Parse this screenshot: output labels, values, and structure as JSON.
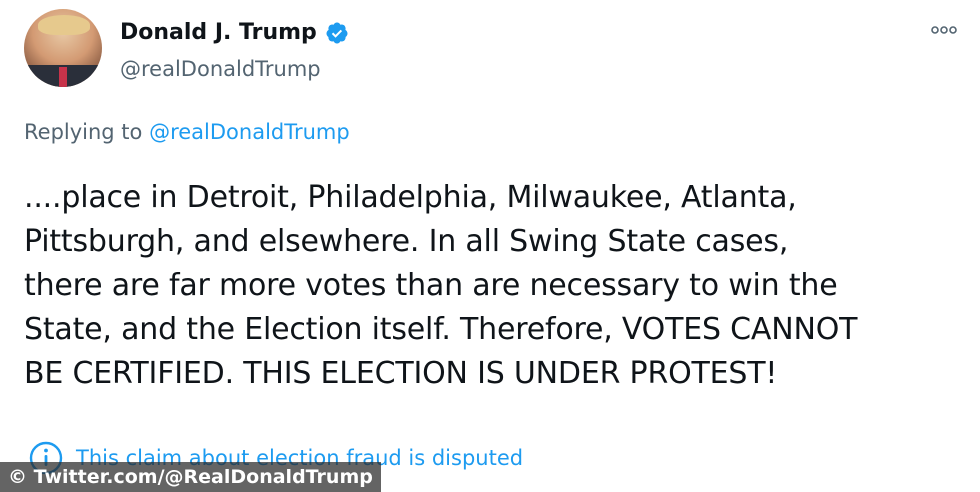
{
  "author": {
    "name": "Donald J. Trump",
    "handle": "@realDonaldTrump",
    "verified": true,
    "avatar_icon": "profile-photo"
  },
  "reply": {
    "prefix": "Replying to ",
    "target": "@realDonaldTrump"
  },
  "tweet": {
    "text": "....place in Detroit, Philadelphia, Milwaukee, Atlanta,\nPittsburgh, and elsewhere. In all Swing State cases,\nthere are far more votes than are necessary to win the\nState, and the Election itself. Therefore, VOTES CANNOT\nBE CERTIFIED. THIS ELECTION IS UNDER PROTEST!"
  },
  "notice": {
    "text": "This claim about election fraud is disputed",
    "icon": "info-icon"
  },
  "watermark": {
    "text": "© Twitter.com/@RealDonaldTrump"
  },
  "colors": {
    "accent": "#1d9bf0",
    "secondary_text": "#536471",
    "primary_text": "#0f1419"
  }
}
